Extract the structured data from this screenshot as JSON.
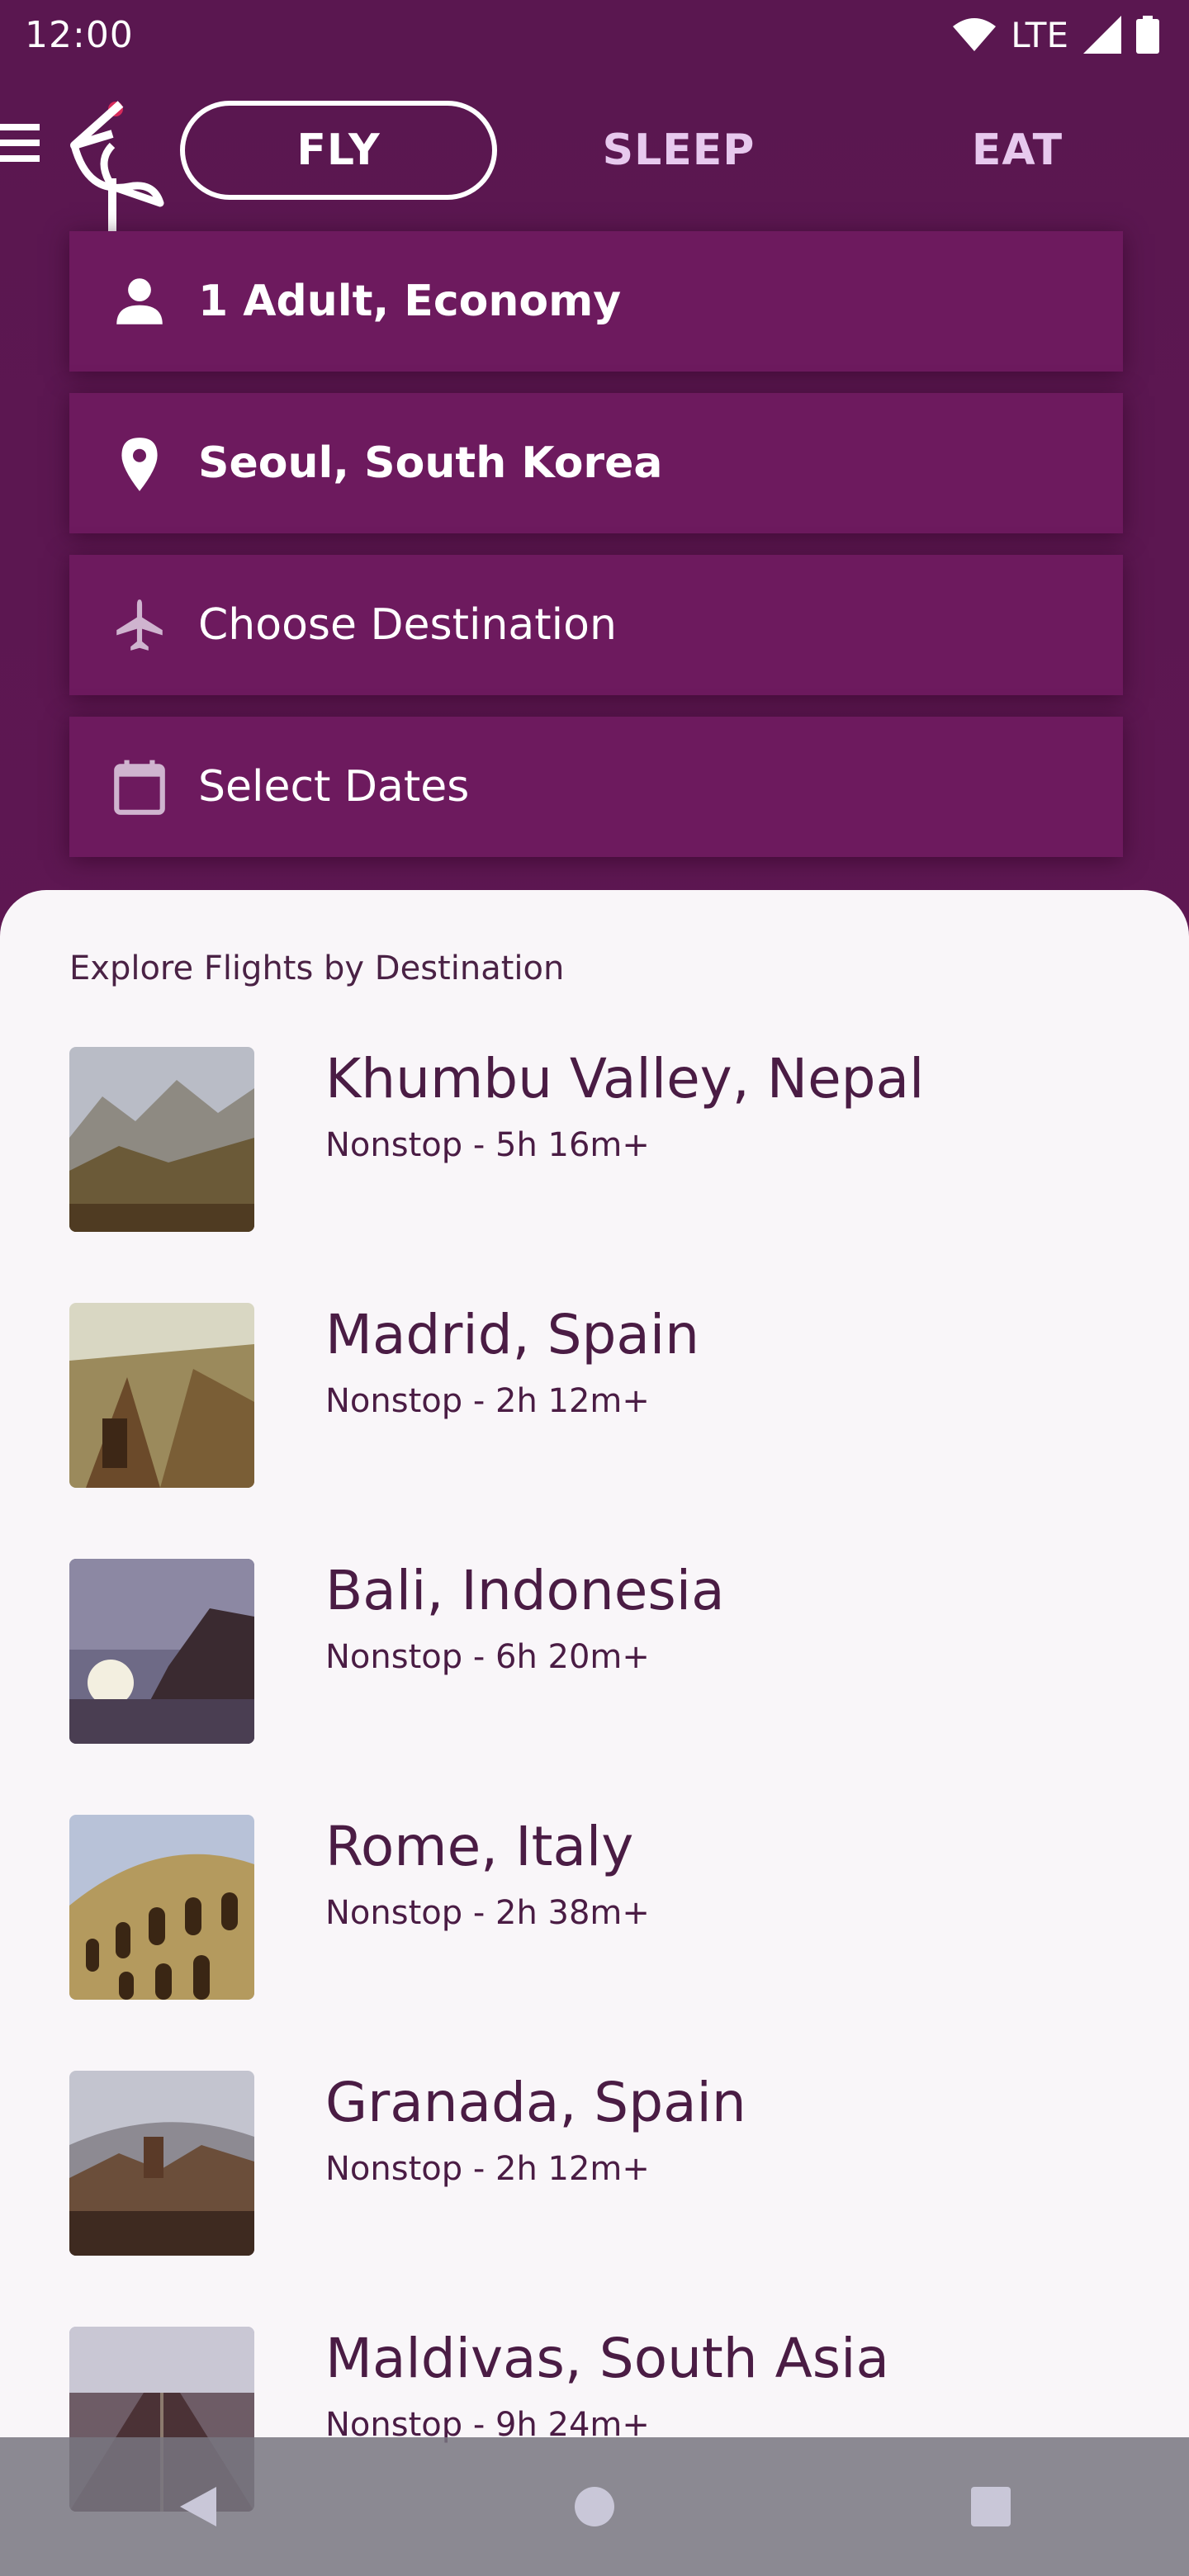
{
  "status_bar": {
    "time": "12:00",
    "network": "LTE"
  },
  "tabs": [
    {
      "label": "FLY",
      "active": true
    },
    {
      "label": "SLEEP",
      "active": false
    },
    {
      "label": "EAT",
      "active": false
    }
  ],
  "search": {
    "passengers": "1 Adult, Economy",
    "origin": "Seoul, South Korea",
    "destination_placeholder": "Choose Destination",
    "dates_placeholder": "Select Dates"
  },
  "explore": {
    "title": "Explore Flights by Destination",
    "items": [
      {
        "name": "Khumbu Valley, Nepal",
        "detail": "Nonstop - 5h 16m+"
      },
      {
        "name": "Madrid, Spain",
        "detail": "Nonstop - 2h 12m+"
      },
      {
        "name": "Bali, Indonesia",
        "detail": "Nonstop - 6h 20m+"
      },
      {
        "name": "Rome, Italy",
        "detail": "Nonstop - 2h 38m+"
      },
      {
        "name": "Granada, Spain",
        "detail": "Nonstop - 2h 12m+"
      },
      {
        "name": "Maldivas, South Asia",
        "detail": "Nonstop - 9h 24m+"
      }
    ]
  },
  "colors": {
    "primary": "#5e1752",
    "field": "#6d1a5e",
    "sheet": "#f9f6f9",
    "text_dark": "#4a1c44"
  }
}
